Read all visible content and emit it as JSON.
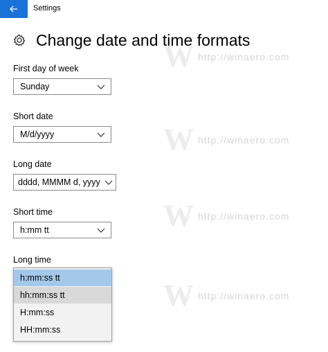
{
  "window": {
    "title": "Settings"
  },
  "page": {
    "title": "Change date and time formats"
  },
  "fields": {
    "first_day": {
      "label": "First day of week",
      "value": "Sunday"
    },
    "short_date": {
      "label": "Short date",
      "value": "M/d/yyyy"
    },
    "long_date": {
      "label": "Long date",
      "value": "dddd, MMMM d, yyyy"
    },
    "short_time": {
      "label": "Short time",
      "value": "h:mm tt"
    },
    "long_time": {
      "label": "Long time",
      "options": [
        "h:mm:ss tt",
        "hh:mm:ss tt",
        "H:mm:ss",
        "HH:mm:ss"
      ],
      "selected": "h:mm:ss tt"
    }
  },
  "watermark": {
    "text": "http://winaero.com",
    "glyph": "W"
  },
  "colors": {
    "accent": "#1a73d9",
    "selected": "#a3c8ea",
    "hover": "#d8d8d8"
  },
  "icons": {
    "back": "back-arrow-icon",
    "settings": "gear-icon",
    "dropdown": "chevron-down-icon"
  }
}
